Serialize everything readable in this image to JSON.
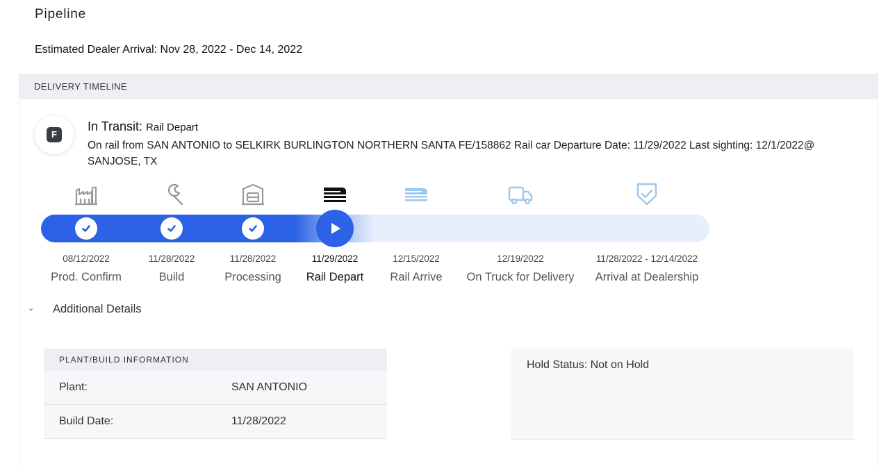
{
  "page": {
    "title": "Pipeline",
    "estimated_arrival": "Estimated Dealer Arrival: Nov 28, 2022 - Dec 14, 2022"
  },
  "timeline": {
    "header": "DELIVERY TIMELINE",
    "avatar_letter": "F",
    "status_label": "In Transit:",
    "status_value": "Rail Depart",
    "description": "On rail from SAN ANTONIO to SELKIRK BURLINGTON NORTHERN SANTA FE/158862 Rail car Departure Date: 11/29/2022 Last sighting: 12/1/2022@ SANJOSE, TX",
    "progress_fraction": 0.43,
    "steps": [
      {
        "date": "08/12/2022",
        "label": "Prod. Confirm",
        "state": "complete",
        "icon": "factory-icon"
      },
      {
        "date": "11/28/2022",
        "label": "Build",
        "state": "complete",
        "icon": "wrench-icon"
      },
      {
        "date": "11/28/2022",
        "label": "Processing",
        "state": "complete",
        "icon": "vehicle-processing-icon"
      },
      {
        "date": "11/29/2022",
        "label": "Rail Depart",
        "state": "current",
        "icon": "rail-car-icon"
      },
      {
        "date": "12/15/2022",
        "label": "Rail Arrive",
        "state": "pending",
        "icon": "rail-car-icon"
      },
      {
        "date": "12/19/2022",
        "label": "On Truck for Delivery",
        "state": "pending",
        "icon": "truck-icon"
      },
      {
        "date": "11/28/2022 - 12/14/2022",
        "label": "Arrival at Dealership",
        "state": "pending",
        "icon": "shield-check-icon"
      }
    ]
  },
  "details": {
    "toggle_label": "Additional Details",
    "plant_header": "PLANT/BUILD INFORMATION",
    "plant_rows": [
      {
        "key": "Plant:",
        "value": "SAN ANTONIO"
      },
      {
        "key": "Build Date:",
        "value": "11/28/2022"
      }
    ],
    "hold_status": "Hold Status: Not on Hold"
  },
  "colors": {
    "accent": "#2c62e6",
    "track": "#e7eefc",
    "done_icon": "#9a9a9a",
    "pending_icon": "#9cc8ee",
    "current_icon": "#111111"
  }
}
